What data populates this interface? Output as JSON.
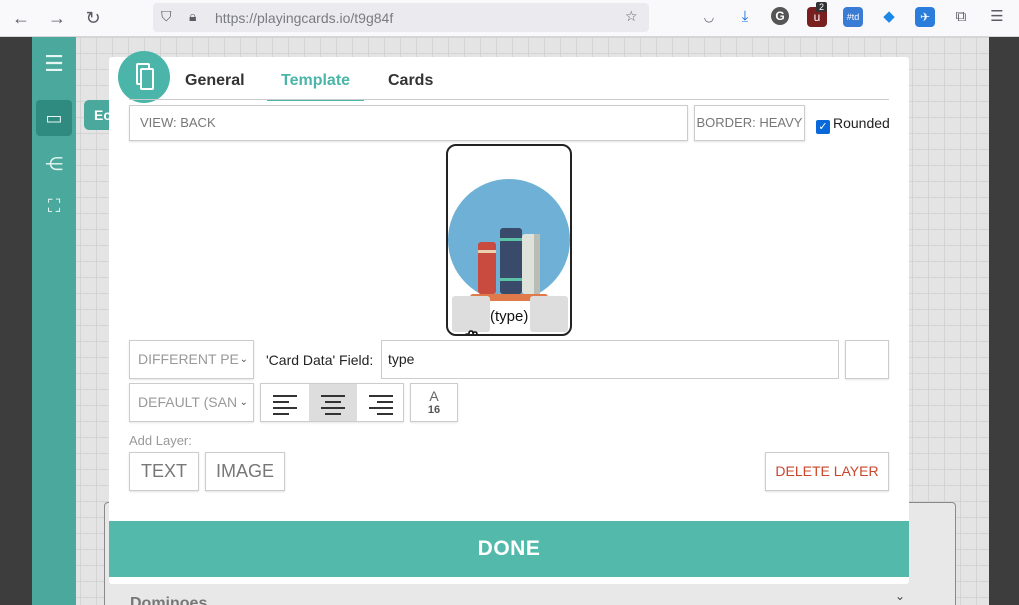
{
  "browser": {
    "url_host": "https://playingcards.io/",
    "url_path": "t9g84f",
    "badge_count": "2",
    "td_label": "#td"
  },
  "sidebar": {
    "editor_tab_label": "Ec"
  },
  "modal": {
    "tabs": [
      "General",
      "Template",
      "Cards"
    ],
    "active_tab": "Template",
    "view_select": "VIEW: BACK",
    "border_select": "BORDER: HEAVY",
    "rounded_label": "Rounded",
    "rounded_checked": true,
    "card_preview_text": "(type)",
    "layer": {
      "mode_select": "DIFFERENT PE",
      "field_label": "'Card Data' Field:",
      "field_value": "type",
      "font_select": "DEFAULT (SAN",
      "alignment": "center",
      "size_letter": "A",
      "size_value": "16"
    },
    "add_layer_label": "Add Layer:",
    "text_button": "TEXT",
    "image_button": "IMAGE",
    "delete_button": "DELETE LAYER",
    "done_button": "DONE"
  },
  "background": {
    "panel_label": "Dominoes"
  },
  "colors": {
    "accent": "#4ab5a8",
    "done": "#52b9ab",
    "delete": "#c8472d",
    "checkbox": "#0a69d9"
  }
}
